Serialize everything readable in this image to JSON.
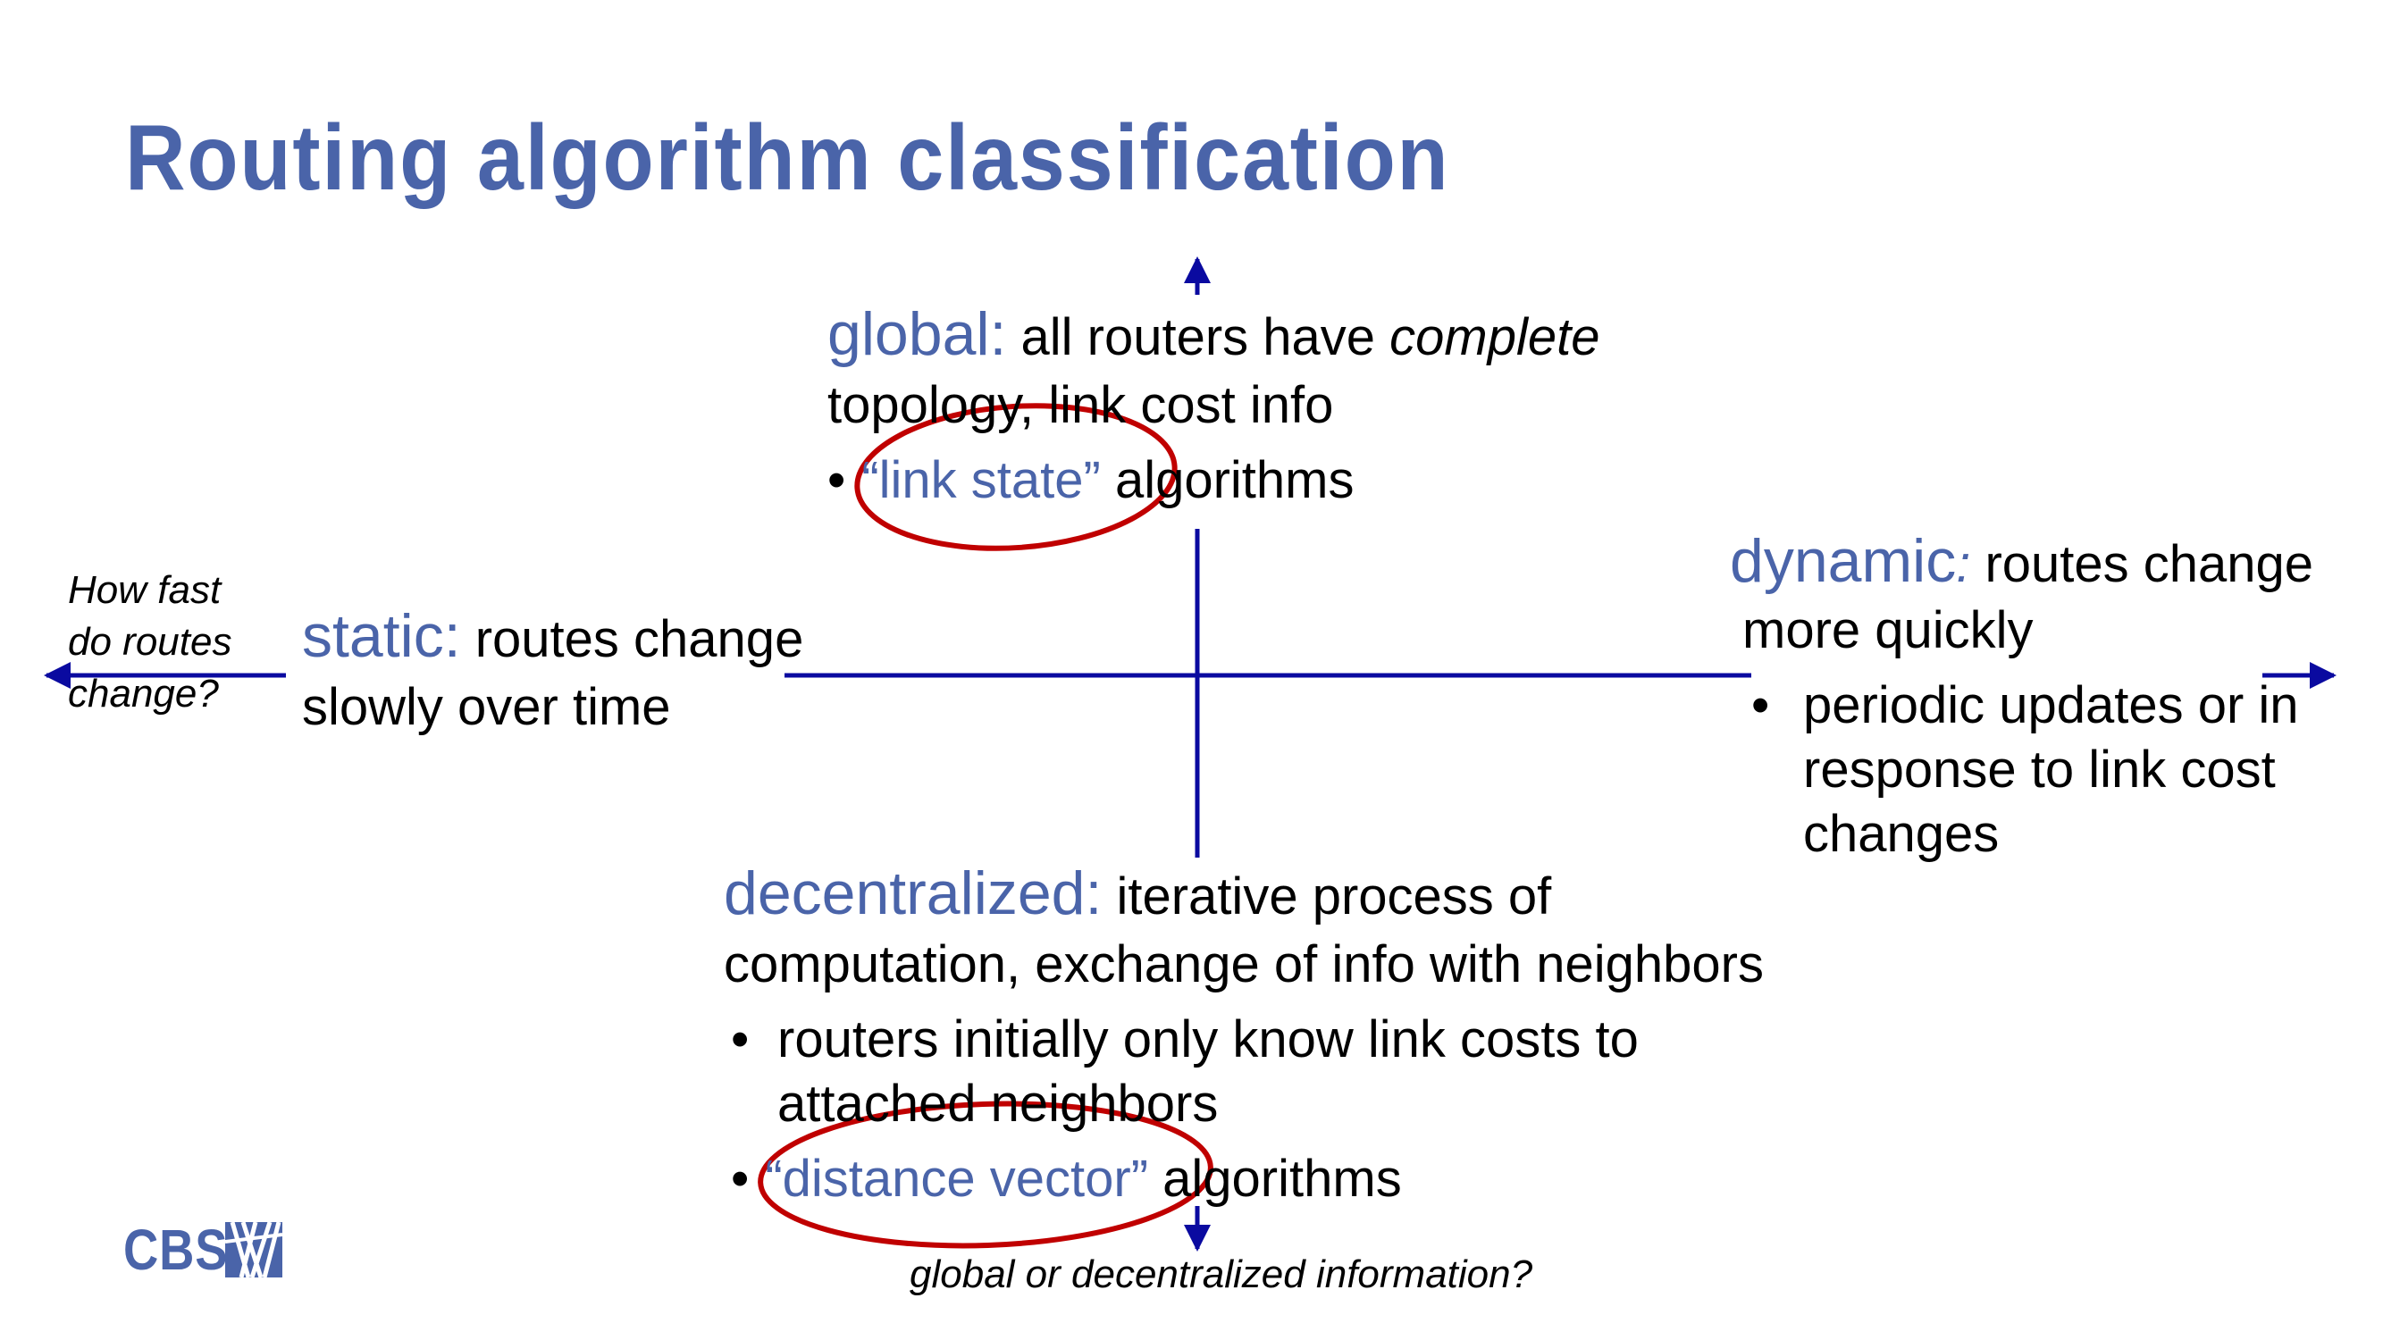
{
  "slide": {
    "title": "Routing algorithm classification",
    "colors": {
      "accent": "#4a64a9",
      "axis": "#0a0aa0",
      "circle": "#c00000"
    },
    "global": {
      "term": "global:",
      "desc_a": " all routers have ",
      "desc_em": "complete",
      "desc_b": "topology, link cost info",
      "bullet_term": "“link state”",
      "bullet_rest": " algorithms"
    },
    "static": {
      "term": "static:",
      "desc_a": " routes change",
      "desc_b": "slowly over time"
    },
    "dynamic": {
      "term": "dynamic",
      "colon": ":",
      "desc_a": " routes change",
      "desc_b": "more quickly",
      "bullet_1": "periodic updates or in",
      "bullet_2": "response to link cost",
      "bullet_3": "changes"
    },
    "decentralized": {
      "term": "decentralized:",
      "desc_a": " iterative process of",
      "desc_b": "computation, exchange of info with neighbors",
      "bullet1_a": "routers initially only know link costs to",
      "bullet1_b": "attached neighbors",
      "bullet2_term": "“distance vector”",
      "bullet2_rest": " algorithms"
    },
    "axis_labels": {
      "horizontal_1": "How fast",
      "horizontal_2": "do routes",
      "horizontal_3": "change?",
      "vertical": "global or decentralized information?"
    },
    "logo": {
      "text": "CBS",
      "icon": "cbs-logo-icon"
    },
    "bullet_char": "•"
  }
}
